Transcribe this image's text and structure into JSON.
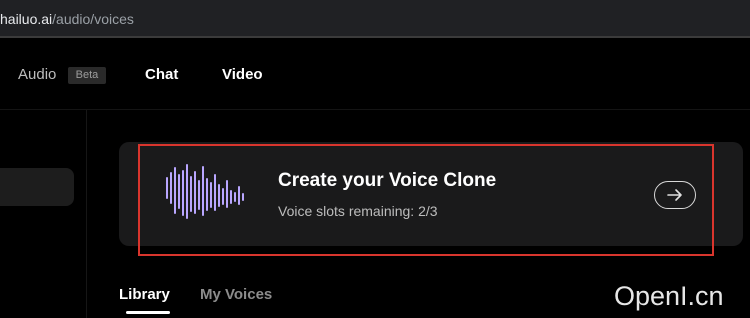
{
  "browser": {
    "url_domain": "hailuo.ai",
    "url_path": "/audio/voices"
  },
  "nav": {
    "audio_label": "Audio",
    "beta_badge": "Beta",
    "chat_label": "Chat",
    "video_label": "Video"
  },
  "clone_card": {
    "title": "Create your Voice Clone",
    "subtitle": "Voice slots remaining: 2/3",
    "icon": "waveform-icon",
    "action_icon": "arrow-right-icon",
    "accent_color": "#b9a6ff",
    "highlight_color": "#d9352d"
  },
  "tabs": [
    {
      "label": "Library",
      "active": true
    },
    {
      "label": "My Voices",
      "active": false
    }
  ],
  "watermark": {
    "text": "OpenI.cn"
  }
}
